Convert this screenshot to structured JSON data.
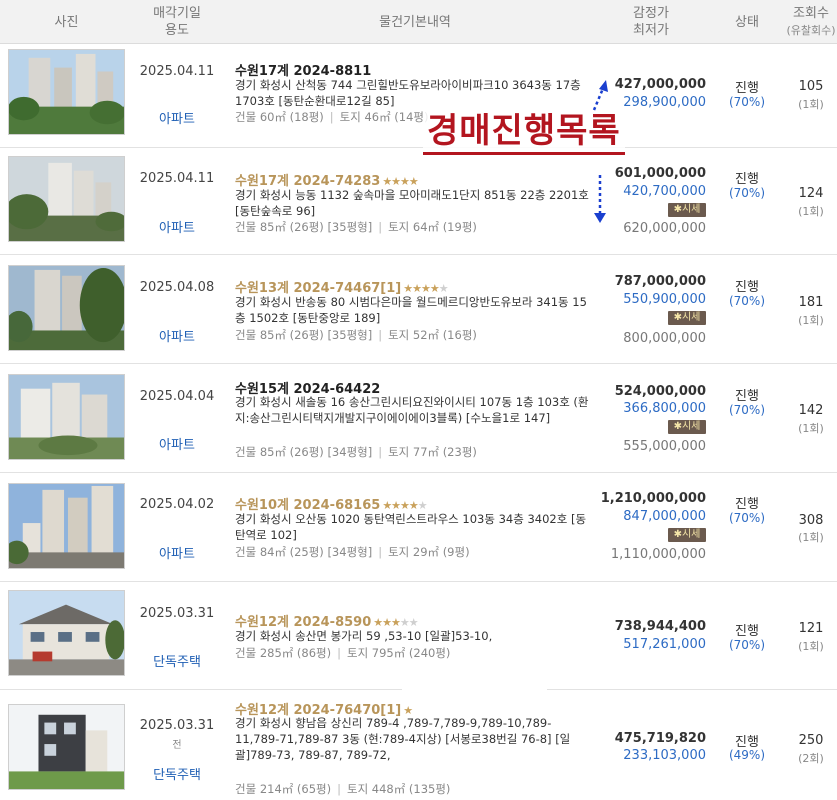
{
  "header": {
    "photo": "사진",
    "date_line1": "매각기일",
    "date_line2": "용도",
    "info": "물건기본내역",
    "price_line1": "감정가",
    "price_line2": "최저가",
    "status": "상태",
    "views_line1": "조회수",
    "views_line2": "(유찰회수)"
  },
  "overlay": {
    "title": "경매진행목록"
  },
  "rows": [
    {
      "date": "2025.04.11",
      "use": "아파트",
      "case": "수원17계 2024-8811",
      "stars_on": 0,
      "stars_total": 0,
      "address": "경기 화성시 산척동 744 그린힐반도유보라아이비파크10 3643동 17층 1703호 [동탄순환대로12길 85]",
      "building": "건물 60㎡ (18평)",
      "land": "토지 46㎡ (14평)",
      "appraisal": "427,000,000",
      "minimum": "298,900,000",
      "market_label": "",
      "market_value": "",
      "status": "진행",
      "percent": "(70%)",
      "views": "105",
      "failed": "(1회)"
    },
    {
      "date": "2025.04.11",
      "use": "아파트",
      "case": "수원17계 2024-74283",
      "stars_on": 4,
      "stars_total": 4,
      "address": "경기 화성시 능동 1132 숲속마을 모아미래도1단지 851동 22층 2201호 [동탄숲속로 96]",
      "building": "건물 85㎡ (26평) [35평형]",
      "land": "토지 64㎡ (19평)",
      "appraisal": "601,000,000",
      "minimum": "420,700,000",
      "market_label": "시세",
      "market_value": "620,000,000",
      "status": "진행",
      "percent": "(70%)",
      "views": "124",
      "failed": "(1회)"
    },
    {
      "date": "2025.04.08",
      "use": "아파트",
      "case": "수원13계 2024-74467[1]",
      "stars_on": 4,
      "stars_total": 5,
      "address": "경기 화성시 반송동 80 시범다은마을 월드메르디앙반도유보라 341동 15층 1502호 [동탄중앙로 189]",
      "building": "건물 85㎡ (26평) [35평형]",
      "land": "토지 52㎡ (16평)",
      "appraisal": "787,000,000",
      "minimum": "550,900,000",
      "market_label": "시세",
      "market_value": "800,000,000",
      "status": "진행",
      "percent": "(70%)",
      "views": "181",
      "failed": "(1회)"
    },
    {
      "date": "2025.04.04",
      "use": "아파트",
      "case": "수원15계 2024-64422",
      "stars_on": 0,
      "stars_total": 0,
      "address": "경기 화성시 새솔동 16 송산그린시티요진와이시티 107동 1층 103호 (환지:송산그린시티택지개발지구이에이에이3블록) [수노을1로 147]",
      "building": "건물 85㎡ (26평) [34평형]",
      "land": "토지 77㎡ (23평)",
      "appraisal": "524,000,000",
      "minimum": "366,800,000",
      "market_label": "시세",
      "market_value": "555,000,000",
      "status": "진행",
      "percent": "(70%)",
      "views": "142",
      "failed": "(1회)"
    },
    {
      "date": "2025.04.02",
      "use": "아파트",
      "case": "수원10계 2024-68165",
      "stars_on": 4,
      "stars_total": 5,
      "address": "경기 화성시 오산동 1020 동탄역린스트라우스 103동 34층 3402호 [동탄역로 102]",
      "building": "건물 84㎡ (25평) [34평형]",
      "land": "토지 29㎡ (9평)",
      "appraisal": "1,210,000,000",
      "minimum": "847,000,000",
      "market_label": "시세",
      "market_value": "1,110,000,000",
      "status": "진행",
      "percent": "(70%)",
      "views": "308",
      "failed": "(1회)"
    },
    {
      "date": "2025.03.31",
      "use": "단독주택",
      "case": "수원12계 2024-8590",
      "stars_on": 3,
      "stars_total": 5,
      "address": "경기 화성시 송산면 봉가리 59 ,53-10 [일괄]53-10,",
      "building": "건물 285㎡ (86평)",
      "land": "토지 795㎡ (240평)",
      "appraisal": "738,944,400",
      "minimum": "517,261,000",
      "market_label": "",
      "market_value": "",
      "status": "진행",
      "percent": "(70%)",
      "views": "121",
      "failed": "(1회)"
    },
    {
      "date": "2025.03.31",
      "use": "단독주택",
      "sub": "전",
      "case": "수원12계 2024-76470[1]",
      "stars_on": 1,
      "stars_total": 1,
      "address": "경기 화성시 향남읍 상신리 789-4 ,789-7,789-9,789-10,789-11,789-71,789-87 3동 (현:789-4지상) [서봉로38번길 76-8] [일괄]789-73, 789-87, 789-72,",
      "building": "건물 214㎡ (65평)",
      "land": "토지 448㎡ (135평)",
      "appraisal": "475,719,820",
      "minimum": "233,103,000",
      "market_label": "",
      "market_value": "",
      "status": "진행",
      "percent": "(49%)",
      "views": "250",
      "failed": "(2회)"
    }
  ]
}
